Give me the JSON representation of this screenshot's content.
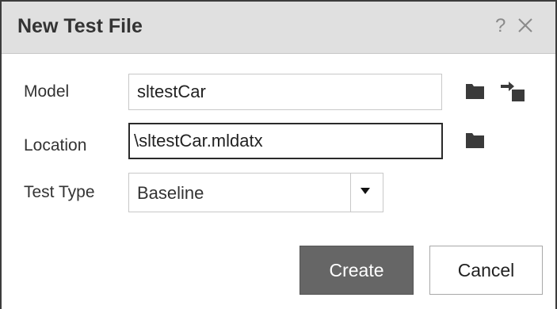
{
  "dialog": {
    "title": "New Test File",
    "help_glyph": "?",
    "close_icon": "close-icon"
  },
  "form": {
    "model": {
      "label": "Model",
      "value": "sltestCar",
      "icons": [
        "folder-icon",
        "open-model-icon"
      ]
    },
    "location": {
      "label": "Location",
      "value": "\\sltestCar.mldatx",
      "icons": [
        "folder-icon"
      ]
    },
    "test_type": {
      "label": "Test Type",
      "selected": "Baseline"
    }
  },
  "buttons": {
    "create_label": "Create",
    "cancel_label": "Cancel"
  },
  "colors": {
    "titlebar_bg": "#e0e0e0",
    "primary_button": "#666666",
    "icon": "#3a3a3a"
  }
}
